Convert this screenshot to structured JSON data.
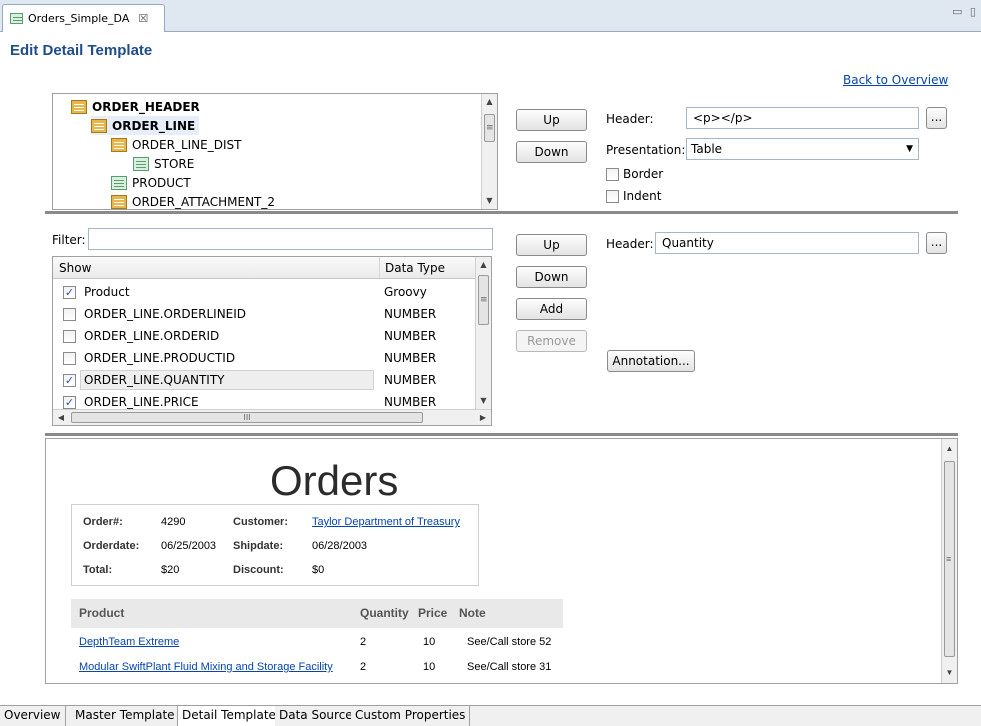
{
  "editor_tab": {
    "title": "Orders_Simple_DA",
    "close": "☒",
    "window_controls": "▭ ▯"
  },
  "page": {
    "title": "Edit Detail Template",
    "back_link": "Back to Overview"
  },
  "tree": {
    "nodes": [
      {
        "label": "ORDER_HEADER",
        "icon": "table-icon",
        "bold": true
      },
      {
        "label": "ORDER_LINE",
        "icon": "table-icon",
        "bold": true,
        "selected": true
      },
      {
        "label": "ORDER_LINE_DIST",
        "icon": "table-icon"
      },
      {
        "label": "STORE",
        "icon": "table-leaf-icon"
      },
      {
        "label": "PRODUCT",
        "icon": "table-leaf-icon"
      },
      {
        "label": "ORDER_ATTACHMENT_2",
        "icon": "table-icon"
      }
    ]
  },
  "top_controls": {
    "up": "Up",
    "down": "Down",
    "header_label": "Header:",
    "header_value": "<p></p>",
    "presentation_label": "Presentation:",
    "presentation_value": "Table",
    "border_label": "Border",
    "indent_label": "Indent",
    "ellipsis": "..."
  },
  "columns_panel": {
    "filter_label": "Filter:",
    "filter_value": "",
    "headers": {
      "show": "Show",
      "type": "Data Type"
    },
    "rows": [
      {
        "name": "Product",
        "type": "Groovy",
        "checked": true
      },
      {
        "name": "ORDER_LINE.ORDERLINEID",
        "type": "NUMBER",
        "checked": false
      },
      {
        "name": "ORDER_LINE.ORDERID",
        "type": "NUMBER",
        "checked": false
      },
      {
        "name": "ORDER_LINE.PRODUCTID",
        "type": "NUMBER",
        "checked": false
      },
      {
        "name": "ORDER_LINE.QUANTITY",
        "type": "NUMBER",
        "checked": true,
        "highlighted": true
      },
      {
        "name": "ORDER_LINE.PRICE",
        "type": "NUMBER",
        "checked": true
      }
    ],
    "hscroll_grip": "III"
  },
  "mid_controls": {
    "up": "Up",
    "down": "Down",
    "add": "Add",
    "remove": "Remove",
    "header_label": "Header:",
    "header_value": "Quantity",
    "annotation": "Annotation...",
    "ellipsis": "..."
  },
  "preview": {
    "title": "Orders",
    "info": {
      "order_no_label": "Order#:",
      "order_no": "4290",
      "customer_label": "Customer:",
      "customer": "Taylor Department of Treasury",
      "orderdate_label": "Orderdate:",
      "orderdate": "06/25/2003",
      "shipdate_label": "Shipdate:",
      "shipdate": "06/28/2003",
      "total_label": "Total:",
      "total": "$20",
      "discount_label": "Discount:",
      "discount": "$0"
    },
    "table": {
      "headers": [
        "Product",
        "Quantity",
        "Price",
        "Note"
      ],
      "rows": [
        {
          "product": "DepthTeam Extreme",
          "quantity": "2",
          "price": "10",
          "note": "See/Call store 52"
        },
        {
          "product": "Modular SwiftPlant Fluid Mixing and Storage Facility",
          "quantity": "2",
          "price": "10",
          "note": "See/Call store 31"
        }
      ]
    }
  },
  "bottom_tabs": [
    "Overview",
    "Master Template",
    "Detail Template",
    "Data Source",
    "Custom Properties"
  ],
  "active_bottom_tab": "Detail Template",
  "colors": {
    "title_blue": "#1f4c8a",
    "link_blue": "#0645ad",
    "check_blue": "#2a55b0"
  }
}
